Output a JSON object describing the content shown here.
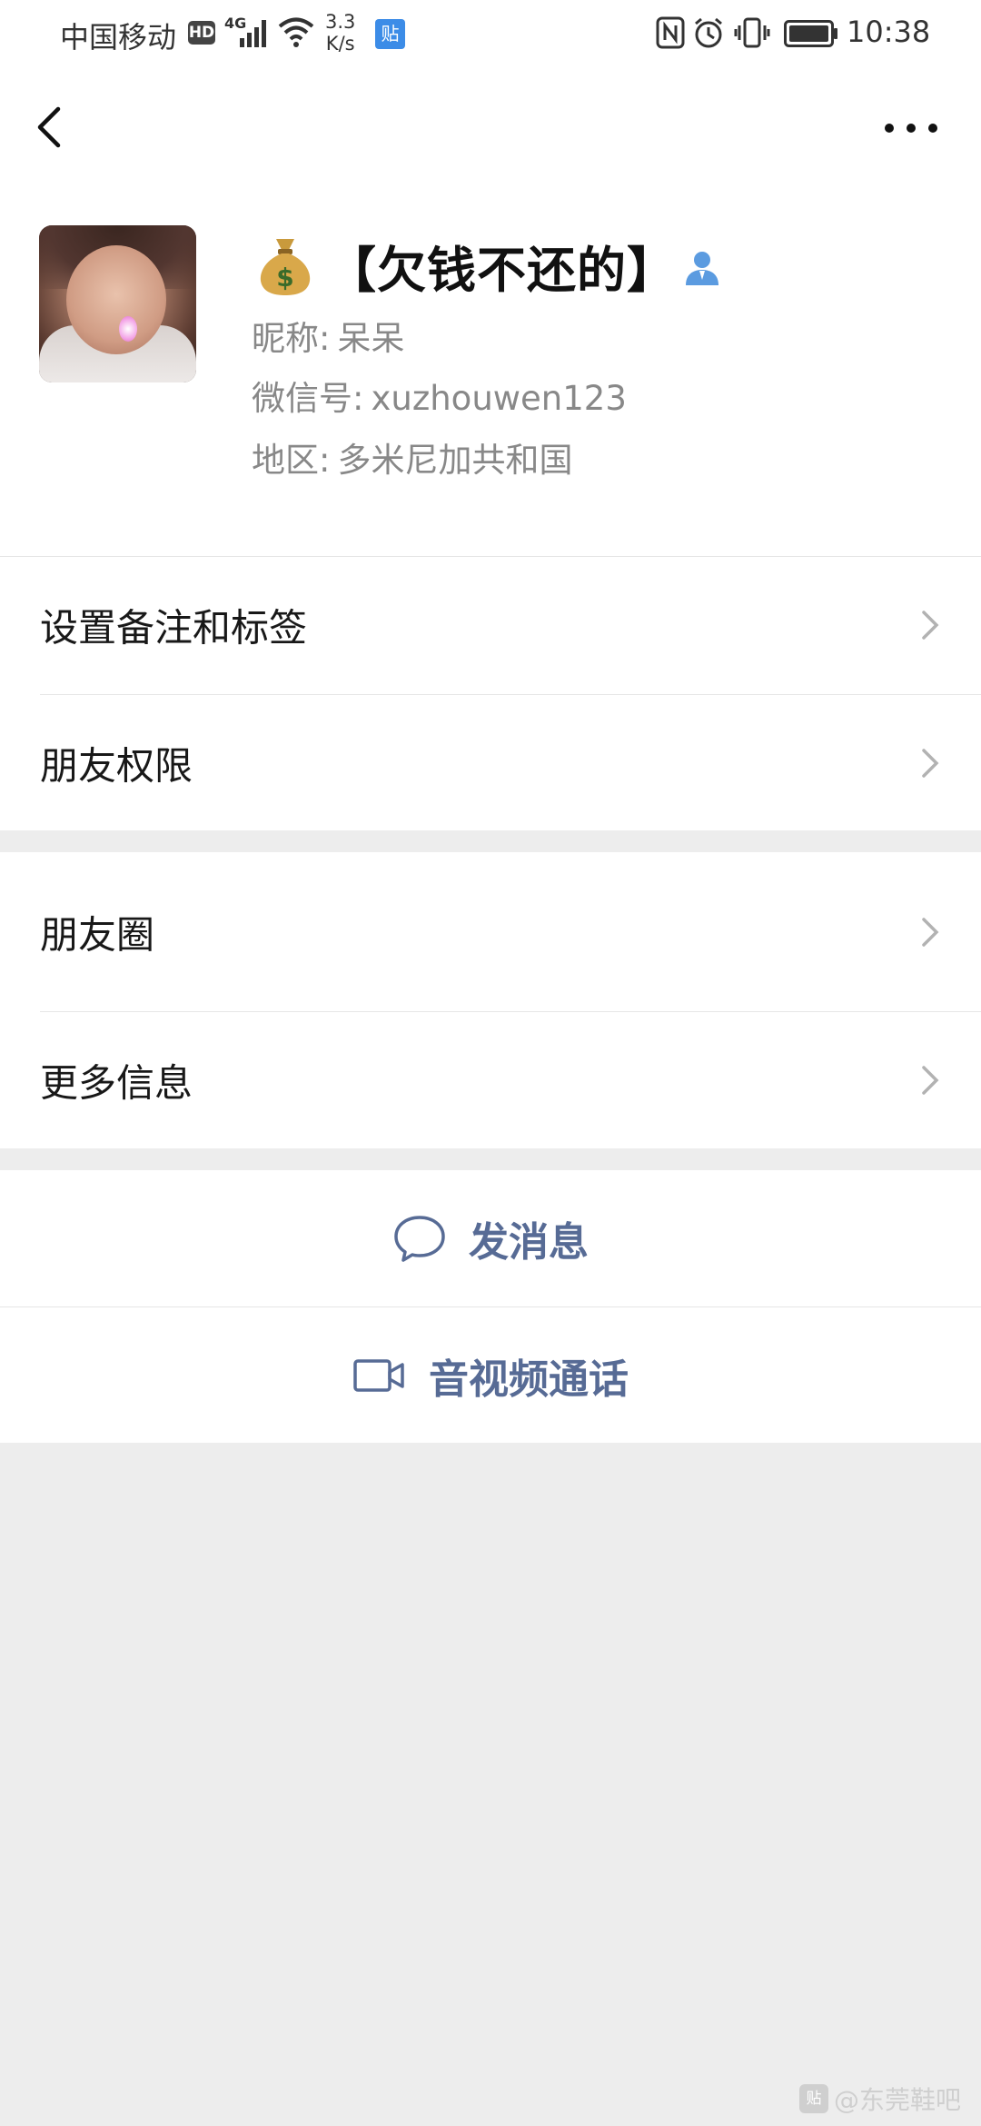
{
  "status_bar": {
    "carrier": "中国移动",
    "hd_badge": "HD",
    "network": "4G",
    "speed_value": "3.3",
    "speed_unit": "K/s",
    "tieba_badge": "贴",
    "time": "10:38"
  },
  "profile": {
    "display_name": "【欠钱不还的】",
    "nickname_label": "昵称:",
    "nickname": "呆呆",
    "wechat_id_label": "微信号:",
    "wechat_id": "xuzhouwen123",
    "region_label": "地区:",
    "region": "多米尼加共和国"
  },
  "menu": {
    "remark_tags": "设置备注和标签",
    "friend_permissions": "朋友权限",
    "moments": "朋友圈",
    "more_info": "更多信息"
  },
  "actions": {
    "send_message": "发消息",
    "voice_video_call": "音视频通话"
  },
  "watermark": {
    "logo": "贴",
    "text": "@东莞鞋吧"
  },
  "colors": {
    "link_blue": "#576b95",
    "background": "#ededed"
  }
}
